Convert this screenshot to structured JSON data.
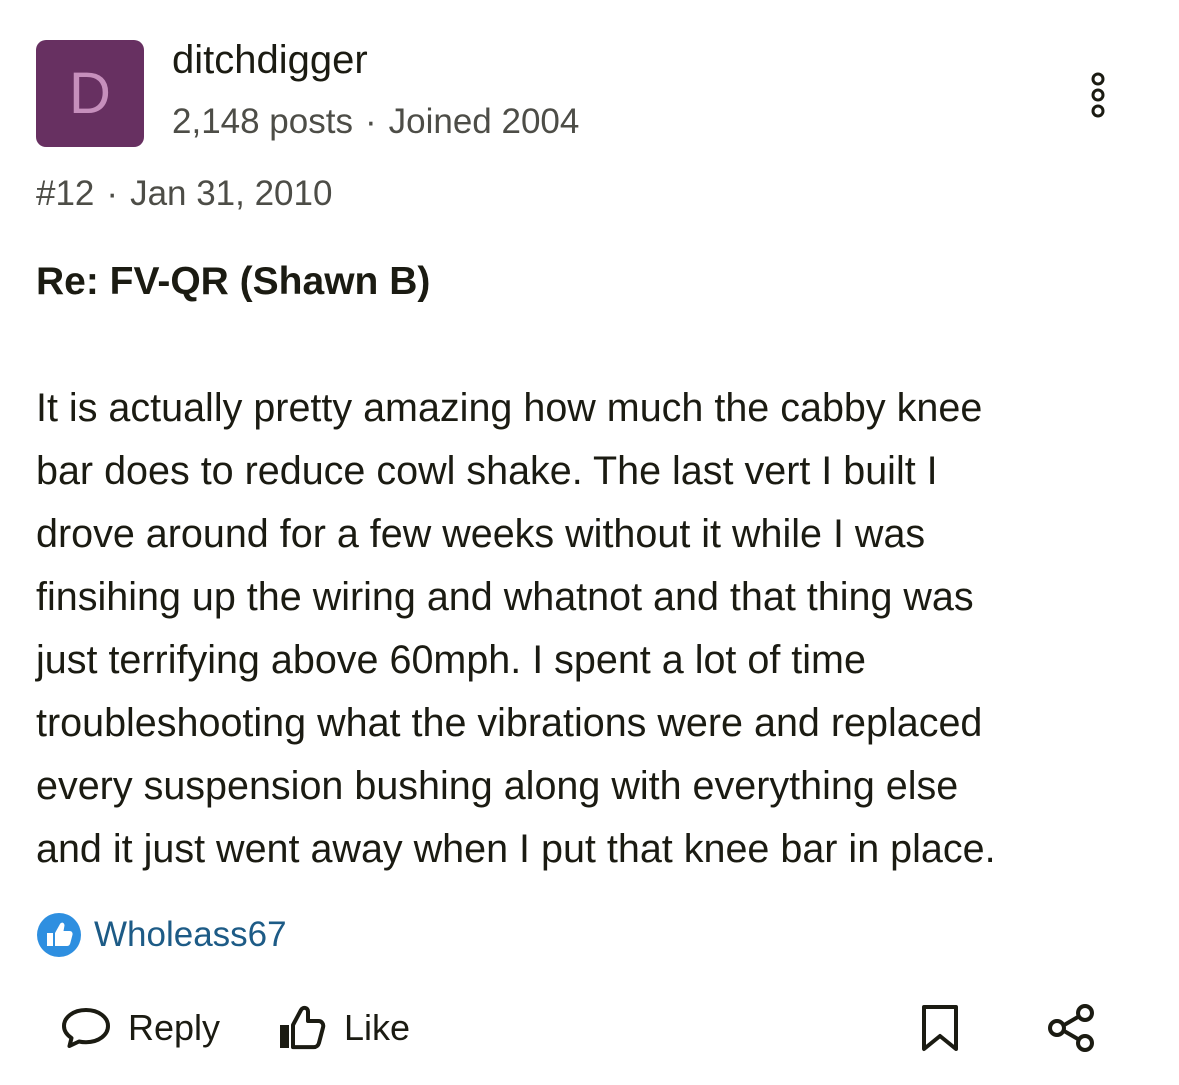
{
  "author": {
    "avatar_letter": "D",
    "avatar_bg": "#673061",
    "avatar_fg": "#c68fbc",
    "username": "ditchdigger",
    "posts": "2,148 posts",
    "separator": "·",
    "joined": "Joined 2004"
  },
  "menu": {
    "icon": "more-vertical-icon"
  },
  "post": {
    "number": "#12",
    "separator": "·",
    "date": "Jan 31, 2010",
    "title": "Re: FV-QR (Shawn B)",
    "body_lines": [
      "It is actually pretty amazing how much the cabby knee",
      "bar does to reduce cowl shake. The last vert I built I",
      "drove around for a few weeks without it while I was",
      "finsihing up the wiring and whatnot and that thing was",
      "just terrifying above 60mph. I spent a lot of time",
      "troubleshooting what the vibrations were and replaced",
      "every suspension bushing along with everything else",
      "and it just went away when I put that knee bar in place."
    ]
  },
  "reactions": {
    "icon": "thumbs-up-badge-icon",
    "color": "#2e8fe0",
    "users": "Wholeass67",
    "link_color": "#1d5b86"
  },
  "actions": {
    "reply_label": "Reply",
    "reply_icon": "speech-bubble-icon",
    "like_label": "Like",
    "like_icon": "thumbs-up-icon",
    "bookmark_icon": "bookmark-icon",
    "share_icon": "share-icon"
  }
}
